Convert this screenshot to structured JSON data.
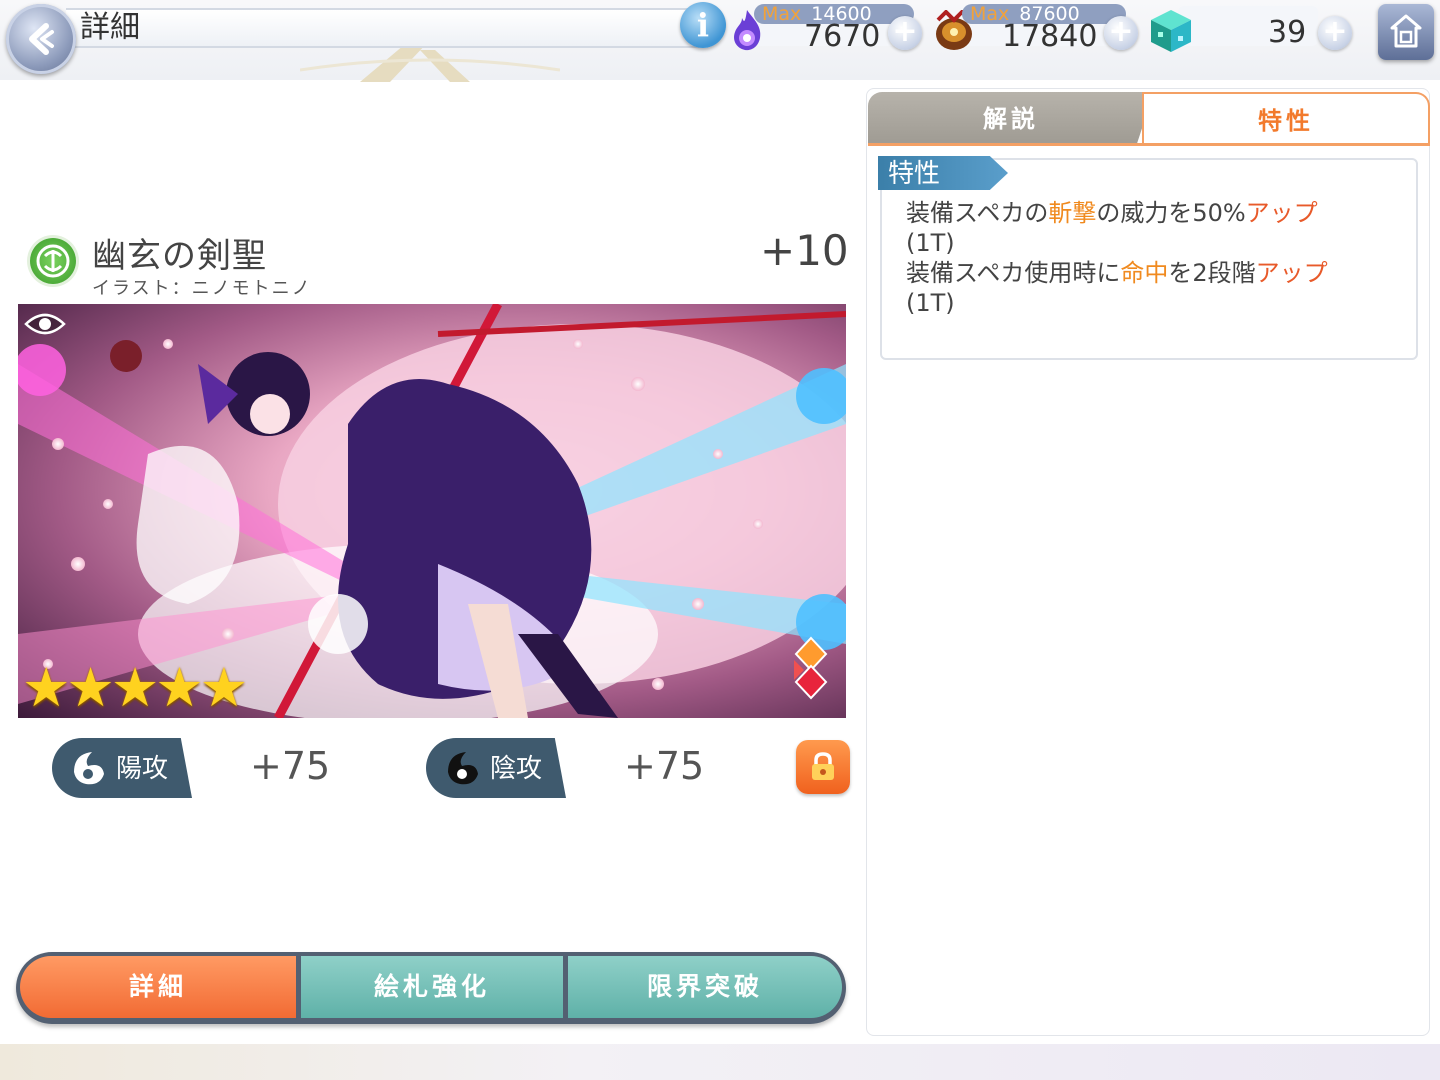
{
  "header": {
    "title": "詳細",
    "info_label": "i",
    "stamina": {
      "max_label": "Max",
      "max_value": "14600",
      "value": "7670"
    },
    "coins": {
      "max_label": "Max",
      "max_value": "87600",
      "value": "17840"
    },
    "gems": {
      "value": "39"
    },
    "plus_label": "+"
  },
  "card": {
    "name": "幽玄の剣聖",
    "illustrator": "イラスト：ニノモトニノ",
    "level": "+10",
    "rarity_stars": 5,
    "star_glyph": "★",
    "stats": [
      {
        "label": "陽攻",
        "value": "+75"
      },
      {
        "label": "陰攻",
        "value": "+75"
      }
    ]
  },
  "bottom_tabs": [
    {
      "label": "詳細",
      "active": true
    },
    {
      "label": "絵札強化",
      "active": false
    },
    {
      "label": "限界突破",
      "active": false
    }
  ],
  "panel": {
    "tabs": [
      {
        "label": "解説",
        "active": false
      },
      {
        "label": "特性",
        "active": true
      }
    ],
    "trait_heading": "特性",
    "trait_lines": [
      [
        {
          "t": "装備スペカの"
        },
        {
          "t": "斬撃",
          "c": "hl-orange"
        },
        {
          "t": "の威力を50%"
        },
        {
          "t": "アップ",
          "c": "hl-red"
        }
      ],
      [
        {
          "t": "(1T)"
        }
      ],
      [
        {
          "t": "装備スペカ使用時に"
        },
        {
          "t": "命中",
          "c": "hl-orange"
        },
        {
          "t": "を2段階"
        },
        {
          "t": "アップ",
          "c": "hl-red"
        }
      ],
      [
        {
          "t": "(1T)"
        }
      ]
    ]
  },
  "colors": {
    "accent_orange": "#f27a2c",
    "tab_teal": "#5fb1a8",
    "trait_blue": "#3b7fa9"
  }
}
